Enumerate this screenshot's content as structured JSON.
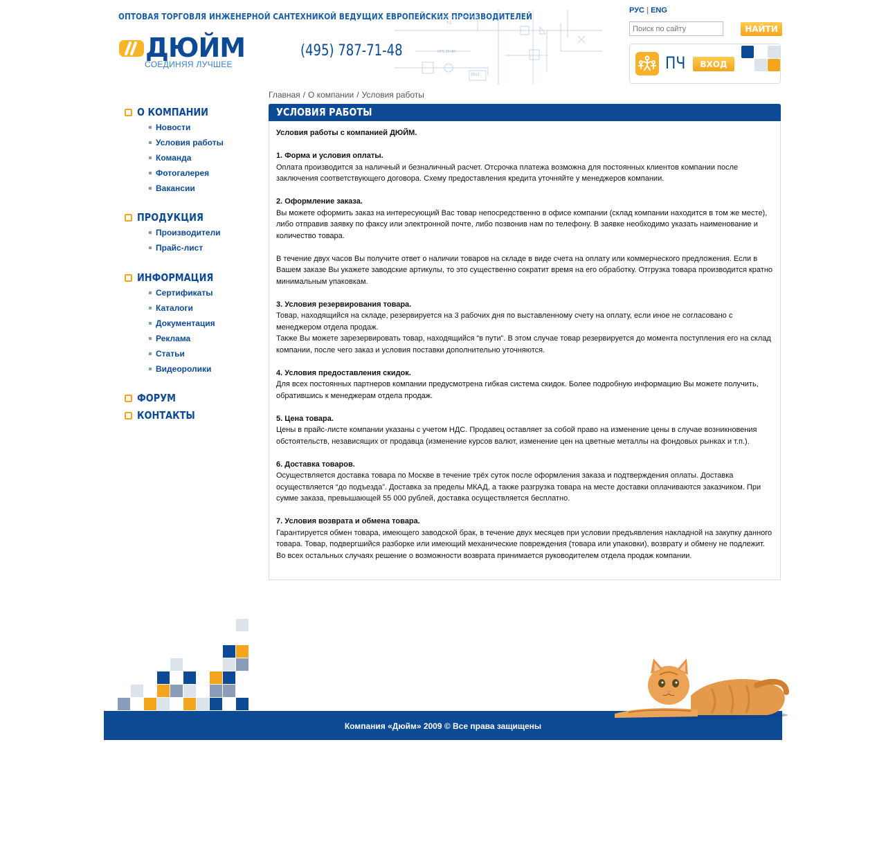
{
  "header": {
    "tagline": "ОПТОВАЯ ТОРГОВЛЯ ИНЖЕНЕРНОЙ САНТЕХНИКОЙ ВЕДУЩИХ ЕВРОПЕЙСКИХ ПРОИЗВОДИТЕЛЕЙ",
    "logo_text": "ДЮЙМ",
    "slogan": "СОЕДИНЯЯ ЛУЧШЕЕ",
    "phone": "(495) 787-71-48",
    "lang_ru": "РУС",
    "lang_separator": "|",
    "lang_en": "ENG",
    "search_placeholder": "Поиск по сайту",
    "search_button": "НАЙТИ",
    "pc_label": "ПЧ",
    "login_button": "ВХОД"
  },
  "colors": {
    "brand_blue": "#0c4a96",
    "accent_orange": "#f4a51d",
    "light_gray": "#dde3ea",
    "muted_blue": "#8a9cb8"
  },
  "breadcrumb": {
    "items": [
      "Главная",
      "О компании",
      "Условия работы"
    ],
    "separator": "/"
  },
  "sidebar": {
    "sections": [
      {
        "label": "О КОМПАНИИ",
        "items": [
          "Новости",
          "Условия работы",
          "Команда",
          "Фотогалерея",
          "Вакансии"
        ]
      },
      {
        "label": "ПРОДУКЦИЯ",
        "items": [
          "Производители",
          "Прайс-лист"
        ]
      },
      {
        "label": "ИНФОРМАЦИЯ",
        "items": [
          "Сертификаты",
          "Каталоги",
          "Документация",
          "Реклама",
          "Статьи",
          "Видеоролики"
        ]
      },
      {
        "label": "ФОРУМ",
        "items": []
      },
      {
        "label": "КОНТАКТЫ",
        "items": []
      }
    ]
  },
  "content": {
    "title": "УСЛОВИЯ РАБОТЫ",
    "intro": "Условия работы с компанией ДЮЙМ.",
    "s1_title": "1. Форма и условия оплаты.",
    "s1_text": "Оплата производится за наличный и безналичный расчет. Отсрочка платежа возможна для постоянных клиентов компании после заключения соответствующего договора. Схему предоставления кредита уточняйте у менеджеров компании.",
    "s2_title": "2. Оформление заказа.",
    "s2_text": "Вы можете оформить заказ на интересующий Вас товар непосредственно в офисе компании (склад компании находится в том же месте), либо отправив заявку по факсу или электронной почте, либо позвонив нам по телефону. В заявке необходимо указать наименование и количество товара.",
    "s2_text2": "В течение двух часов Вы получите ответ о наличии товаров на складе в виде счета на оплату или коммерческого предложения. Если в Вашем заказе Вы укажете заводские артикулы, то это существенно сократит время на его обработку. Отгрузка товара производится кратно минимальным упаковкам.",
    "s3_title": "3. Условия резервирования товара.",
    "s3_text": "Товар, находящийся на складе, резервируется на 3 рабочих дня по выставленному счету на оплату, если иное не согласовано с менеджером отдела продаж.",
    "s3_text2": "Также Вы можете зарезервировать товар, находящийся “в пути”. В этом случае товар резервируется до момента поступления его на склад компании, после чего заказ и условия поставки дополнительно уточняются.",
    "s4_title": "4. Условия предоставления скидок.",
    "s4_text": "Для всех постоянных партнеров компании предусмотрена гибкая система скидок. Более подробную информацию Вы можете получить, обратившись к менеджерам отдела продаж.",
    "s5_title": "5. Цена товара.",
    "s5_text": "Цены в прайс-листе компании указаны с учетом НДС. Продавец оставляет за собой право на изменение цены в случае возникновения обстоятельств, независящих от продавца (изменение курсов валют, изменение цен на цветные металлы на фондовых рынках и т.п.).",
    "s6_title": "6. Доставка товаров.",
    "s6_text": "Осуществляется доставка товара по Москве в течение трёх суток после оформления заказа и подтверждения оплаты. Доставка осуществляется “до подъезда”. Доставка за пределы МКАД, а также разгрузка товара на месте доставки оплачиваются заказчиком. При сумме заказа, превышающей 55 000 рублей, доставка осуществляется бесплатно.",
    "s7_title": "7. Условия возврата и обмена товара.",
    "s7_text": "Гарантируется обмен товара, имеющего заводской брак, в течение двух месяцев при условии предъявления накладной на закупку данного товара. Товар, подвергшийся разборке или имеющий механические повреждения (товара или упаковки), возврату и обмену не подлежит. Во всех остальных случаях решение о возможности возврата принимается руководителем отдела продаж компании."
  },
  "footer": {
    "copyright": "Компания «Дюйм» 2009 © Все права защищены"
  }
}
